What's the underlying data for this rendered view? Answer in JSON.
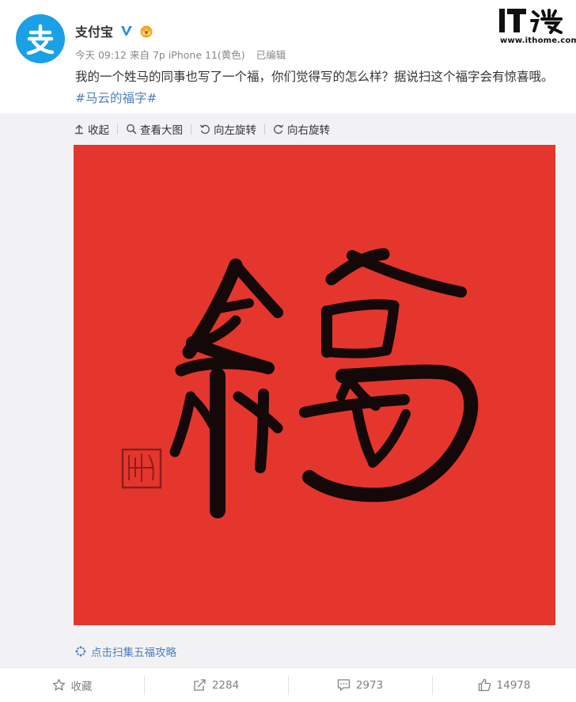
{
  "author": {
    "name": "支付宝",
    "avatar_glyph": "支",
    "verified_icon": "verified-v-icon",
    "vip_icon": "vip-crown-icon",
    "brand_color": "#1aa0e6"
  },
  "meta": {
    "time": "今天 09:12",
    "source": "来自 7p iPhone 11(黄色)",
    "edited": "已编辑"
  },
  "watermark": {
    "logo_text": "IT之家",
    "site": "www.ithome.com"
  },
  "post": {
    "text": "我的一个姓马的同事也写了一个福，你们觉得写的怎么样？据说扫这个福字会有惊喜哦。",
    "hashtag": "#马云的福字#",
    "link_color": "#4e7fb9"
  },
  "media": {
    "toolbar": [
      {
        "icon": "collapse-icon",
        "label": "收起"
      },
      {
        "icon": "zoom-icon",
        "label": "查看大图"
      },
      {
        "icon": "rotate-left-icon",
        "label": "向左旋转"
      },
      {
        "icon": "rotate-right-icon",
        "label": "向右旋转"
      }
    ],
    "image_background": "#e5362d",
    "calligraphy_character": "福",
    "link": {
      "icon": "sparkle-icon",
      "label": "点击扫集五福攻略"
    }
  },
  "actions": [
    {
      "icon": "star-icon",
      "label": "收藏"
    },
    {
      "icon": "share-icon",
      "label": "2284"
    },
    {
      "icon": "comment-icon",
      "label": "2973"
    },
    {
      "icon": "like-icon",
      "label": "14978"
    }
  ]
}
